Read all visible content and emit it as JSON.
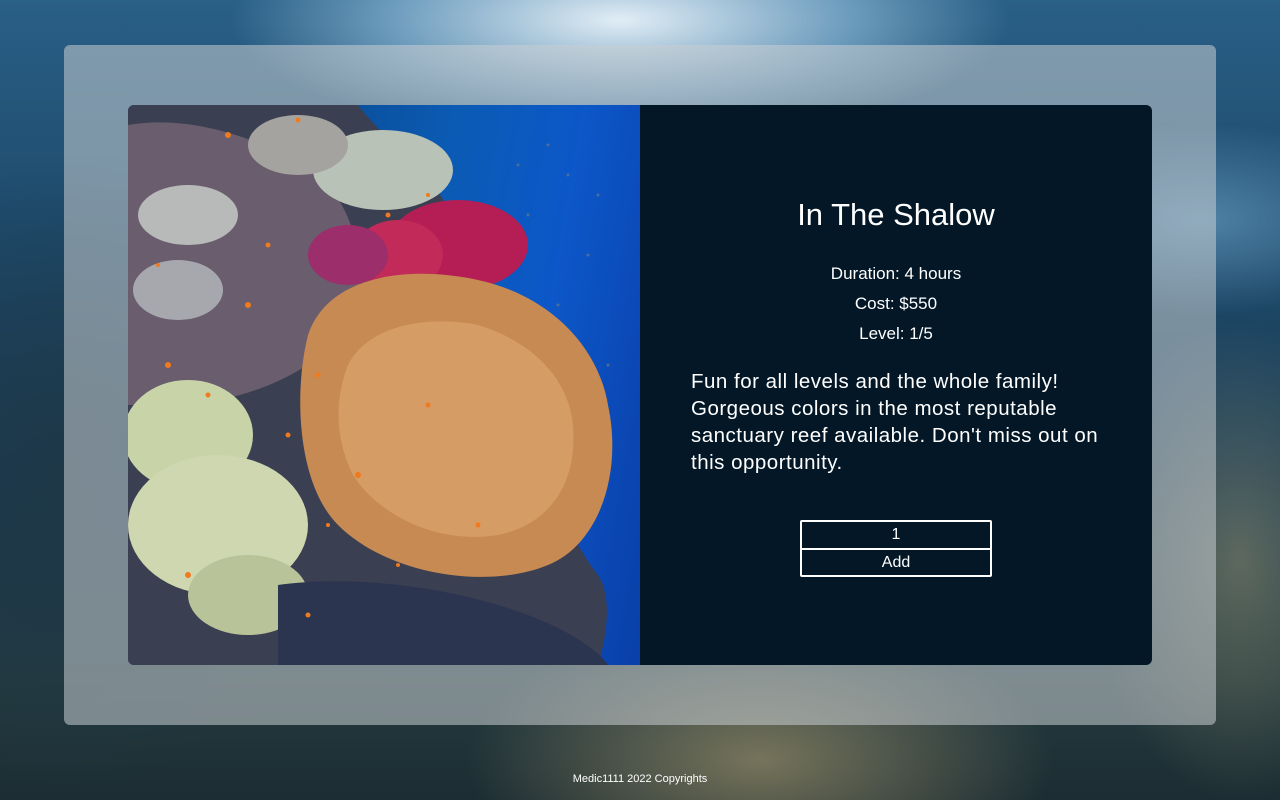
{
  "tour": {
    "title": "In The Shalow",
    "duration": "Duration: 4 hours",
    "cost": "Cost: $550",
    "level": "Level: 1/5",
    "description": "Fun for all levels and the whole family! Gorgeous colors in the most reputable sanctuary reef available. Don't miss out on this opportunity."
  },
  "cart": {
    "quantity_value": "1",
    "add_label": "Add"
  },
  "footer": {
    "text": "Medic1111 2022 Copyrights"
  },
  "colors": {
    "info_panel_bg": "#031726",
    "text": "#ffffff",
    "glass_overlay": "#c8cdd2"
  }
}
